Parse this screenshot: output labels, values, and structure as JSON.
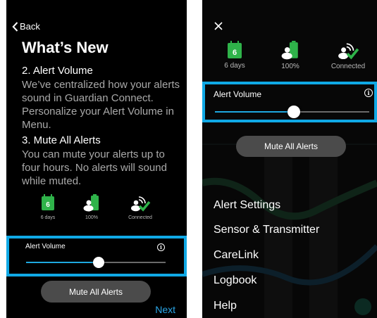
{
  "left": {
    "back_label": "Back",
    "title": "What’s New",
    "section2_heading": "2. Alert Volume",
    "section2_body": [
      "We’ve centralized how your alerts",
      "sound in Guardian Connect.",
      "Personalize your Alert Volume in",
      "Menu."
    ],
    "section3_heading": "3. Mute All Alerts",
    "section3_body": [
      "You can mute your alerts up to",
      "four hours. No alerts will sound",
      "while muted."
    ],
    "status": [
      {
        "icon": "calendar-icon",
        "badge": "6",
        "label": "6 days"
      },
      {
        "icon": "transmitter-battery-icon",
        "label": "100%"
      },
      {
        "icon": "connected-icon",
        "label": "Connected"
      }
    ],
    "alert_volume_label": "Alert Volume",
    "info_glyph": "i",
    "volume_level": 0.52,
    "mute_button_label": "Mute All Alerts",
    "next_label": "Next"
  },
  "right": {
    "status": [
      {
        "icon": "calendar-icon",
        "badge": "6",
        "label": "6 days"
      },
      {
        "icon": "transmitter-battery-icon",
        "label": "100%"
      },
      {
        "icon": "connected-icon",
        "label": "Connected"
      }
    ],
    "alert_volume_label": "Alert Volume",
    "info_glyph": "i",
    "volume_level": 0.51,
    "mute_button_label": "Mute All Alerts",
    "menu_items": [
      "Alert Settings",
      "Sensor & Transmitter",
      "CareLink",
      "Logbook",
      "Help"
    ]
  },
  "colors": {
    "highlight_border": "#10a9e6",
    "slider_fill": "#1ea8e0",
    "green_accent": "#2fb34a",
    "link_blue": "#2aa7e8",
    "button_gray": "#4b4b4b"
  }
}
